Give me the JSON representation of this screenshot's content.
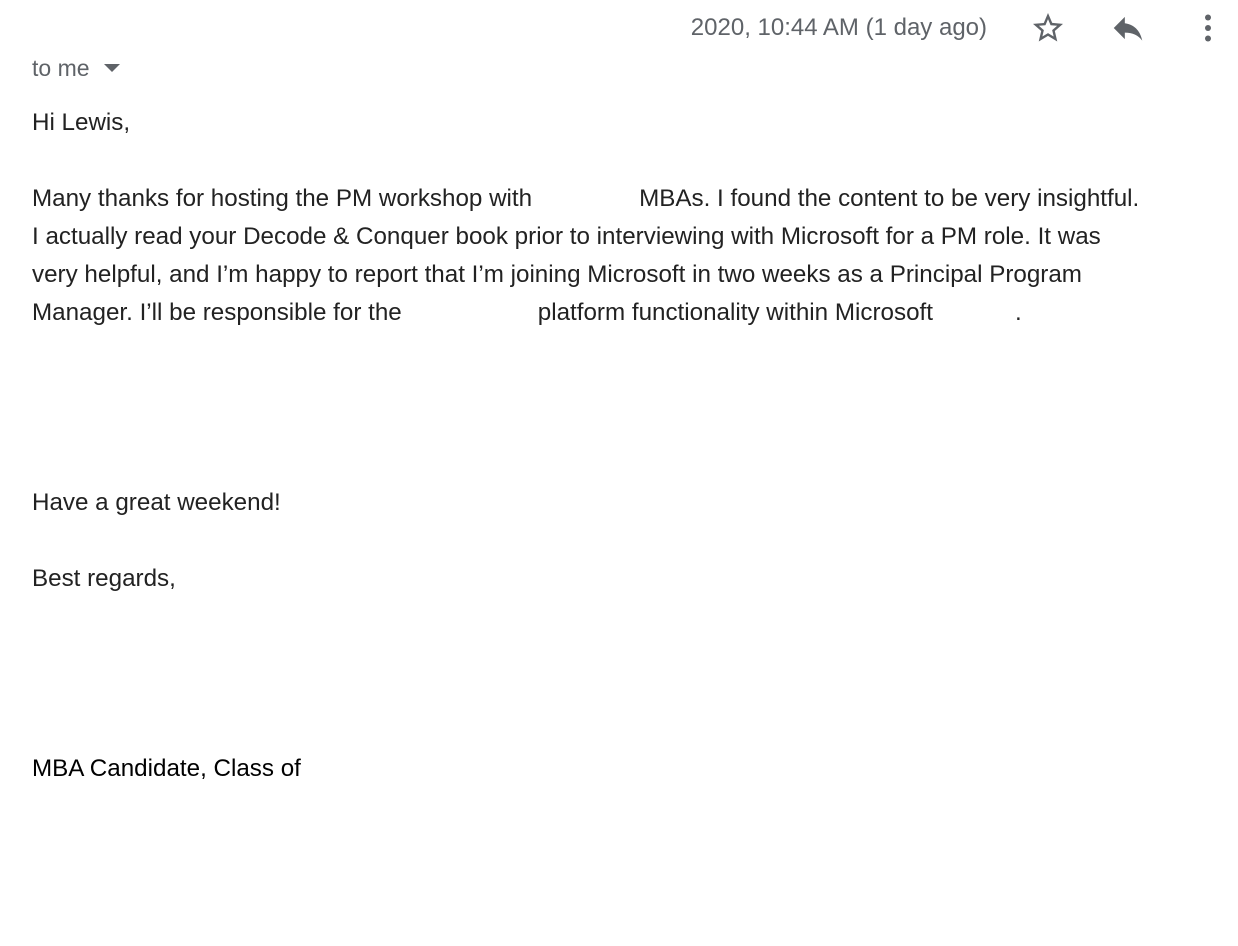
{
  "header": {
    "timestamp": "2020, 10:44 AM (1 day ago)",
    "star_icon": "star-outline-icon",
    "reply_icon": "reply-icon",
    "more_icon": "more-vert-icon"
  },
  "recipient": {
    "label": "to me"
  },
  "message": {
    "greeting": "Hi Lewis,",
    "paragraph": {
      "line1_a": "Many thanks for hosting the PM workshop with",
      "line1_b": "MBAs. I found the content to be very insightful.",
      "line2": "I actually read your Decode & Conquer book prior to interviewing with Microsoft for a PM role. It was",
      "line3": "very helpful, and I’m happy to report that I’m joining Microsoft in two weeks as a Principal Program",
      "line4_a": "Manager. I’ll be responsible for the",
      "line4_b": "platform functionality within Microsoft",
      "line4_c": "."
    },
    "closing": "Have a great weekend!",
    "regards": "Best regards,",
    "signature": "MBA Candidate, Class of"
  },
  "colors": {
    "secondary_text": "#5f6368",
    "body_text": "#222222"
  }
}
